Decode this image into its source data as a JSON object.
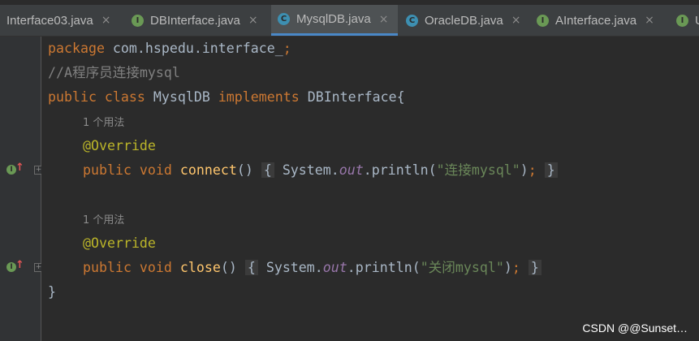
{
  "tabs": [
    {
      "label": "Interface03.java",
      "icon": "interface-icon",
      "close": "×",
      "active": false
    },
    {
      "label": "DBInterface.java",
      "icon": "interface-icon",
      "close": "×",
      "active": false
    },
    {
      "label": "MysqlDB.java",
      "icon": "class-icon",
      "close": "×",
      "active": true
    },
    {
      "label": "OracleDB.java",
      "icon": "class-icon",
      "close": "×",
      "active": false
    },
    {
      "label": "AInterface.java",
      "icon": "interface-icon",
      "close": "×",
      "active": false
    },
    {
      "label": "U",
      "icon": "interface-icon",
      "close": "",
      "active": false
    }
  ],
  "tab_icon_letter": {
    "interface": "I",
    "class": "C"
  },
  "code": {
    "l1_kw": "package",
    "l1_rest": " com.hspedu.interface_",
    "l1_semi": ";",
    "l2_comment": "//A程序员连接mysql",
    "l3_kw": "public class",
    "l3_name": " MysqlDB ",
    "l3_kw2": "implements",
    "l3_rest": " DBInterface{",
    "usage_hint": "1 个用法",
    "annotation": "@Override",
    "kw_public_void": "public void",
    "m1_name": "connect",
    "parens": "()",
    "brace_open": "{",
    "sys": " System.",
    "out": "out",
    "println": ".println(",
    "m1_str": "\"连接mysql\"",
    "close_paren": ")",
    "semicolon": ";",
    "brace_close": "}",
    "m2_name": "close",
    "m2_str": "\"关闭mysql\"",
    "class_close": "}"
  },
  "gutter_icons": {
    "implements_letter": "I",
    "arrow": "↑",
    "fold": "+"
  },
  "watermark": "CSDN @@Sunset…"
}
